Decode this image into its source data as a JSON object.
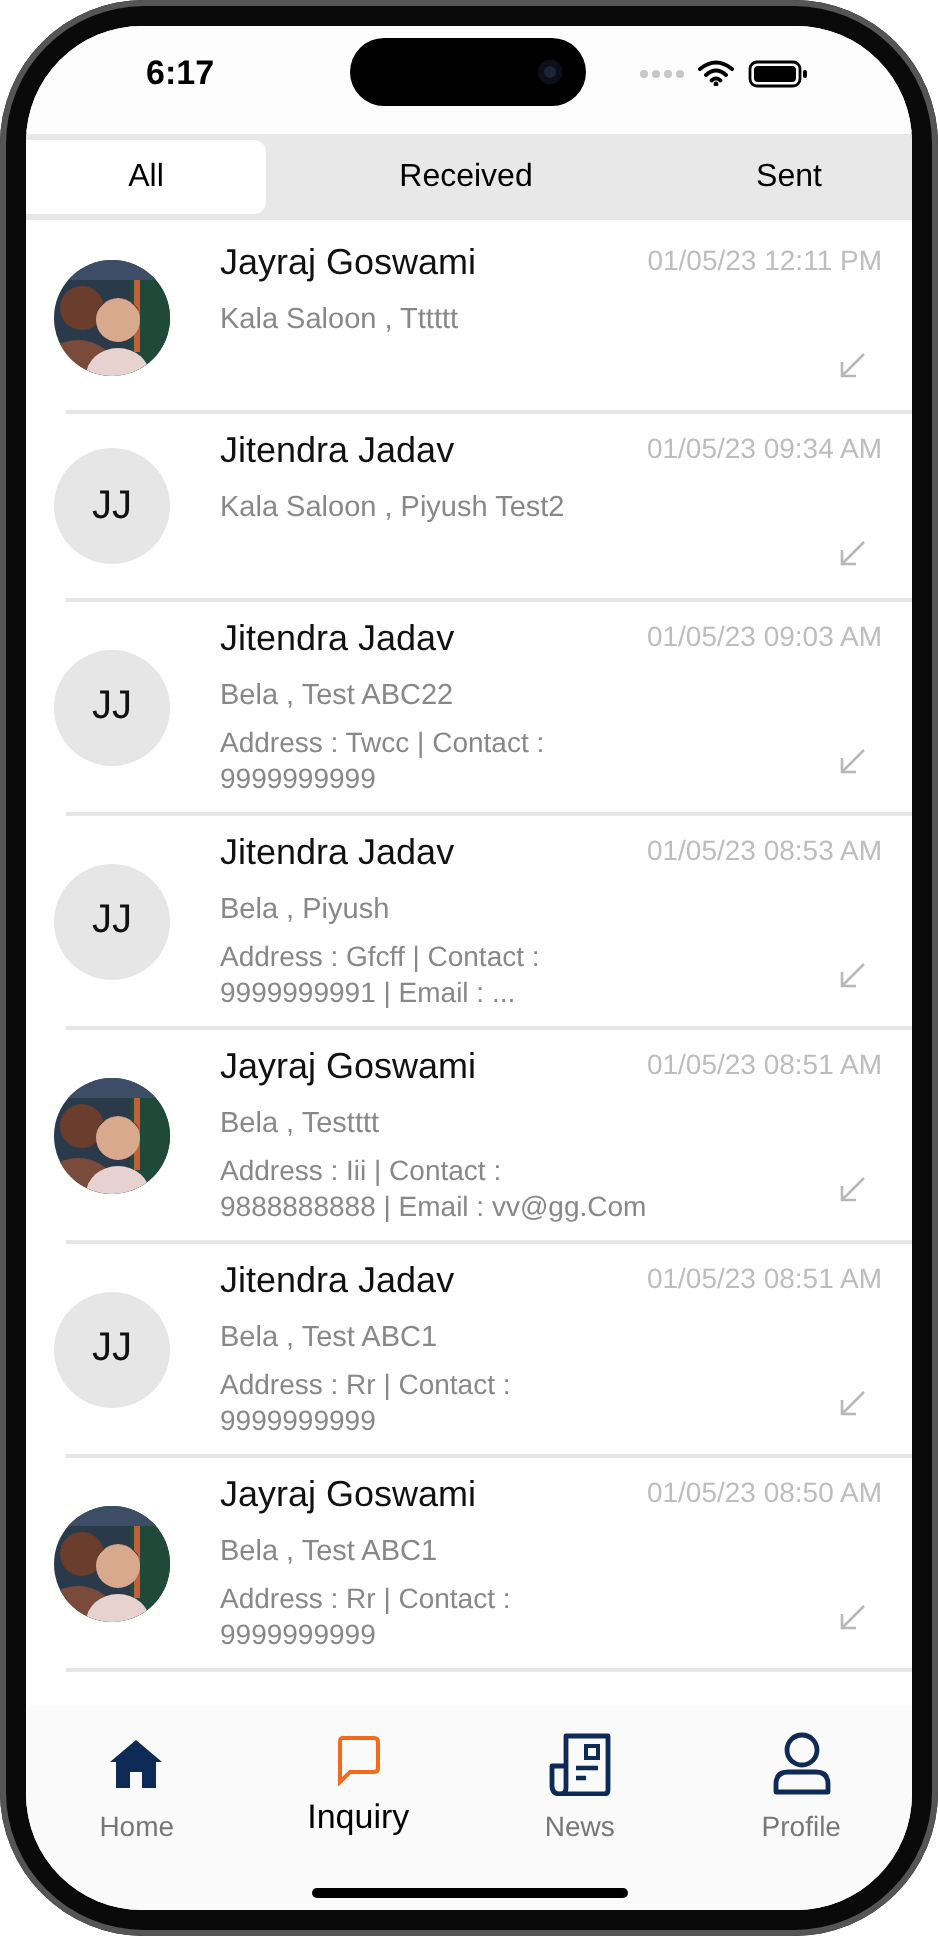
{
  "status_bar": {
    "time": "6:17"
  },
  "tabs": [
    {
      "label": "All",
      "selected": true
    },
    {
      "label": "Received",
      "selected": false
    },
    {
      "label": "Sent",
      "selected": false
    }
  ],
  "inquiries": [
    {
      "name": "Jayraj Goswami",
      "avatar": {
        "kind": "picture"
      },
      "time": "01/05/23 12:11 PM",
      "subtitle": "Kala Saloon , Tttttt"
    },
    {
      "name": "Jitendra Jadav",
      "avatar": {
        "kind": "initials",
        "text": "JJ"
      },
      "time": "01/05/23 09:34 AM",
      "subtitle": "Kala Saloon , Piyush Test2"
    },
    {
      "name": "Jitendra Jadav",
      "avatar": {
        "kind": "initials",
        "text": "JJ"
      },
      "time": "01/05/23 09:03 AM",
      "subtitle": "Bela , Test ABC22",
      "details": [
        "Address : Twcc | Contact :",
        "9999999999"
      ]
    },
    {
      "name": "Jitendra Jadav",
      "avatar": {
        "kind": "initials",
        "text": "JJ"
      },
      "time": "01/05/23 08:53 AM",
      "subtitle": "Bela , Piyush",
      "details": [
        "Address : Gfcff | Contact :",
        "9999999991 | Email : ..."
      ]
    },
    {
      "name": "Jayraj Goswami",
      "avatar": {
        "kind": "picture"
      },
      "time": "01/05/23 08:51 AM",
      "subtitle": "Bela , Testttt",
      "details": [
        "Address : Iii | Contact :",
        "9888888888 | Email : vv@gg.Com"
      ]
    },
    {
      "name": "Jitendra Jadav",
      "avatar": {
        "kind": "initials",
        "text": "JJ"
      },
      "time": "01/05/23 08:51 AM",
      "subtitle": "Bela , Test ABC1",
      "details": [
        "Address : Rr | Contact :",
        "9999999999"
      ]
    },
    {
      "name": "Jayraj Goswami",
      "avatar": {
        "kind": "picture"
      },
      "time": "01/05/23 08:50 AM",
      "subtitle": "Bela , Test ABC1",
      "details": [
        "Address : Rr | Contact :",
        "9999999999"
      ]
    }
  ],
  "bottom_nav": [
    {
      "label": "Home",
      "selected": false
    },
    {
      "label": "Inquiry",
      "selected": true
    },
    {
      "label": "News",
      "selected": false
    },
    {
      "label": "Profile",
      "selected": false
    }
  ]
}
